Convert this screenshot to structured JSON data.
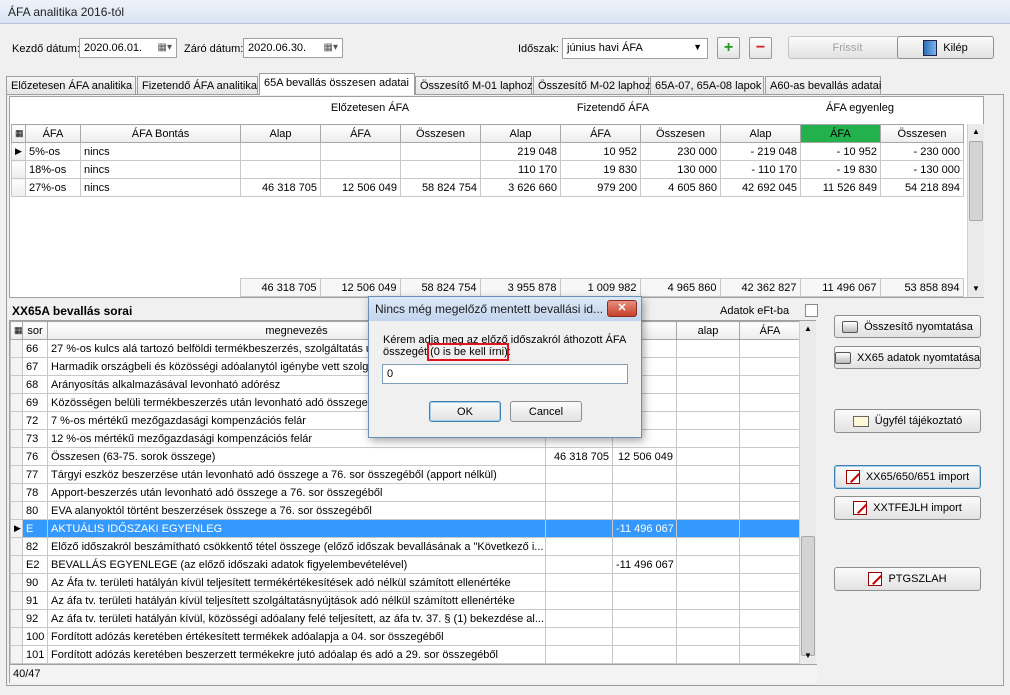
{
  "window": {
    "title": "ÁFA analitika 2016-tól"
  },
  "toolbar": {
    "start_label": "Kezdő dátum:",
    "start_value": "2020.06.01.",
    "end_label": "Záró dátum:",
    "end_value": "2020.06.30.",
    "period_label": "Időszak:",
    "period_value": "június havi ÁFA",
    "refresh_label": "Frissít",
    "exit_label": "Kilép"
  },
  "tabs": [
    "Előzetesen ÁFA analitika",
    "Fizetendő ÁFA analitika",
    "65A bevallás összesen adatai",
    "Összesítő M-01 laphoz",
    "Összesítő M-02 laphoz",
    "65A-07, 65A-08 lapok",
    "A60-as bevallás adatai"
  ],
  "summary": {
    "groups": [
      "Előzetesen ÁFA",
      "Fizetendő ÁFA",
      "ÁFA egyenleg"
    ],
    "headers": [
      "ÁFA",
      "ÁFA Bontás",
      "Alap",
      "ÁFA",
      "Összesen",
      "Alap",
      "ÁFA",
      "Összesen",
      "Alap",
      "ÁFA",
      "Összesen"
    ],
    "rows": [
      [
        "5%-os",
        "nincs",
        "",
        "",
        "",
        "219 048",
        "10 952",
        "230 000",
        "- 219 048",
        "- 10 952",
        "- 230 000"
      ],
      [
        "18%-os",
        "nincs",
        "",
        "",
        "",
        "110 170",
        "19 830",
        "130 000",
        "- 110 170",
        "- 19 830",
        "- 130 000"
      ],
      [
        "27%-os",
        "nincs",
        "46 318 705",
        "12 506 049",
        "58 824 754",
        "3 626 660",
        "979 200",
        "4 605 860",
        "42 692 045",
        "11 526 849",
        "54 218 894"
      ]
    ],
    "totals": [
      "46 318 705",
      "12 506 049",
      "58 824 754",
      "3 955 878",
      "1 009 982",
      "4 965 860",
      "42 362 827",
      "11 496 067",
      "53 858 894"
    ],
    "highlight_color": "#22b14c"
  },
  "lines": {
    "title": "XX65A bevallás sorai",
    "eft_label": "Adatok eFt-ba",
    "headers": [
      "sor",
      "megnevezés",
      "",
      "",
      "alap",
      "ÁFA"
    ],
    "rows": [
      [
        "66",
        "27 %-os kulcs alá tartozó belföldi termékbeszerzés, szolgáltatás után",
        "",
        "",
        "",
        ""
      ],
      [
        "67",
        "Harmadik országbeli és közösségi adóalanytól igénybe vett szolgált",
        "",
        "",
        "",
        ""
      ],
      [
        "68",
        "Arányosítás alkalmazásával levonható adórész",
        "",
        "",
        "",
        ""
      ],
      [
        "69",
        "Közösségen belüli termékbeszerzés után levonható adó összege",
        "",
        "",
        "",
        ""
      ],
      [
        "72",
        "7 %-os mértékű mezőgazdasági kompenzációs felár",
        "",
        "",
        "",
        ""
      ],
      [
        "73",
        "12 %-os mértékű mezőgazdasági kompenzációs felár",
        "",
        "",
        "",
        ""
      ],
      [
        "76",
        "Összesen (63-75. sorok összege)",
        "46 318 705",
        "12 506 049",
        "",
        ""
      ],
      [
        "77",
        "Tárgyi eszköz beszerzése után levonható adó összege a 76. sor összegéből (apport nélkül)",
        "",
        "",
        "",
        ""
      ],
      [
        "78",
        "Apport-beszerzés után levonható adó összege a 76. sor összegéből",
        "",
        "",
        "",
        ""
      ],
      [
        "80",
        "EVA alanyoktól történt beszerzések összege a 76. sor összegéből",
        "",
        "",
        "",
        ""
      ],
      [
        "E",
        "AKTUÁLIS IDŐSZAKI EGYENLEG",
        "",
        "-11 496 067",
        "",
        ""
      ],
      [
        "82",
        "Előző időszakról beszámítható csökkentő tétel összege (előző időszak bevallásának a \"Következő i...",
        "",
        "",
        "",
        ""
      ],
      [
        "E2",
        "BEVALLÁS EGYENLEGE (az előző időszaki adatok figyelembevételével)",
        "",
        "-11 496 067",
        "",
        ""
      ],
      [
        "90",
        "Az Áfa tv. területi hatályán kívül teljesített termékértékesítések adó nélkül számított ellenértéke",
        "",
        "",
        "",
        ""
      ],
      [
        "91",
        "Az áfa tv. területi hatályán kívül teljesített szolgáltatásnyújtások adó nélkül számított ellenértéke",
        "",
        "",
        "",
        ""
      ],
      [
        "92",
        "Az áfa tv. területi hatályán kívül, közösségi adóalany felé teljesített, az áfa tv. 37. § (1) bekezdése al...",
        "",
        "",
        "",
        ""
      ],
      [
        "100",
        "Fordított adózás keretében értékesített termékek adóalapja a 04. sor összegéből",
        "",
        "",
        "",
        ""
      ],
      [
        "101",
        "Fordított adózás keretében beszerzett termékekre jutó adóalap és adó a 29. sor összegéből",
        "",
        "",
        "",
        ""
      ]
    ],
    "selected_code": "E",
    "record_counter": "40/47",
    "selected_color": "#3399ff"
  },
  "side_buttons": [
    {
      "label": "Összesítő nyomtatása",
      "icon": "printer-icon"
    },
    {
      "label": "XX65 adatok nyomtatása",
      "icon": "printer-icon"
    },
    {
      "label": "Ügyfél tájékoztató",
      "icon": "envelope-icon"
    },
    {
      "label": "XX65/650/651 import",
      "icon": "edit-icon"
    },
    {
      "label": "XXTFEJLH import",
      "icon": "edit-icon"
    },
    {
      "label": "PTGSZLAH",
      "icon": "edit-icon"
    }
  ],
  "dialog": {
    "title": "Nincs még megelőző mentett bevallási id...",
    "close_label": "✕",
    "message_line1": "Kérem adja meg az előző időszakról áthozott ÁFA",
    "message_line2a": "összegét ",
    "message_line2b": "(0 is be kell írni):",
    "input_value": "0",
    "ok_label": "OK",
    "cancel_label": "Cancel"
  }
}
